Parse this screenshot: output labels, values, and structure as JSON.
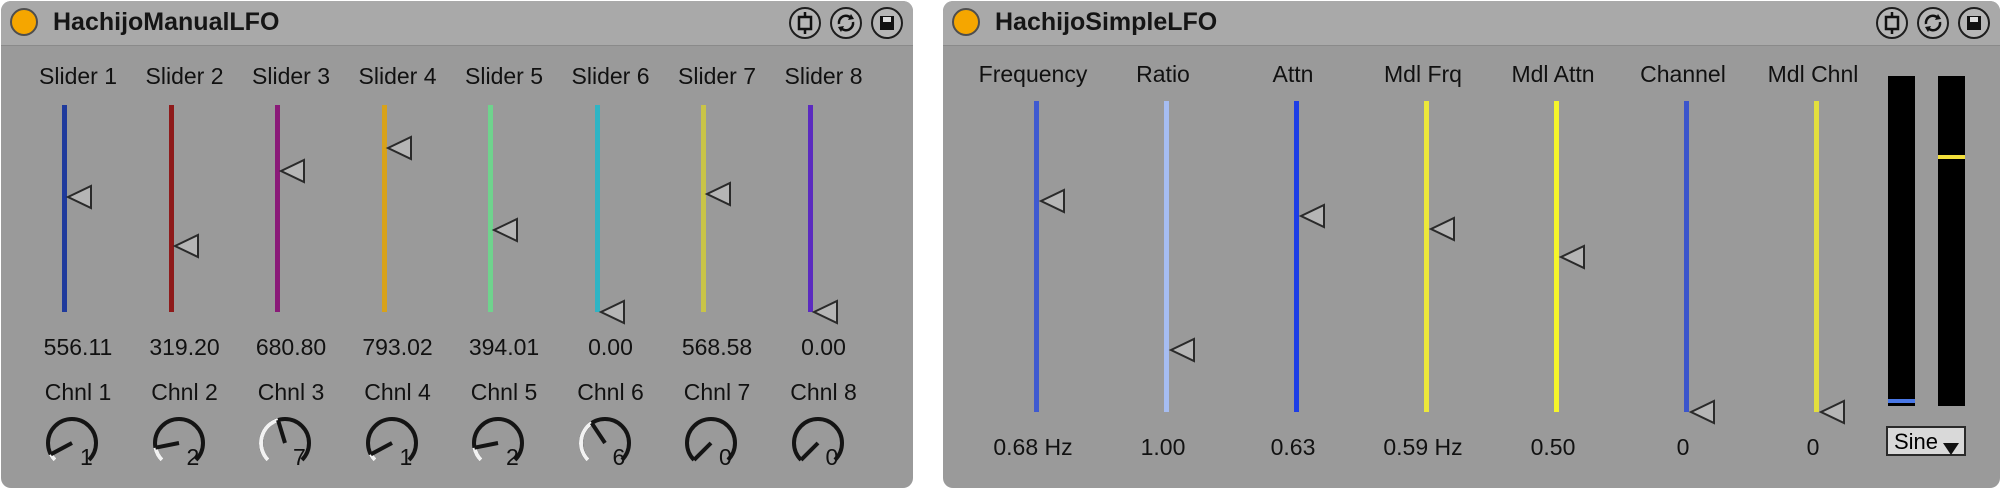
{
  "devices": [
    {
      "title": "HachijoManualLFO",
      "sliders": [
        {
          "label": "Slider 1",
          "value": "556.11",
          "color": "#1f3a9c",
          "level": 0.556
        },
        {
          "label": "Slider 2",
          "value": "319.20",
          "color": "#8e1a1a",
          "level": 0.319
        },
        {
          "label": "Slider 3",
          "value": "680.80",
          "color": "#8a1a78",
          "level": 0.681
        },
        {
          "label": "Slider 4",
          "value": "793.02",
          "color": "#d7a21b",
          "level": 0.793
        },
        {
          "label": "Slider 5",
          "value": "394.01",
          "color": "#6fd38d",
          "level": 0.394
        },
        {
          "label": "Slider 6",
          "value": "0.00",
          "color": "#2fb4c4",
          "level": 0.0
        },
        {
          "label": "Slider 7",
          "value": "568.58",
          "color": "#c9c448",
          "level": 0.569
        },
        {
          "label": "Slider 8",
          "value": "0.00",
          "color": "#5b2ac0",
          "level": 0.0
        }
      ],
      "channels": [
        {
          "label": "Chnl 1",
          "value": "1",
          "level": 0.0625
        },
        {
          "label": "Chnl 2",
          "value": "2",
          "level": 0.125
        },
        {
          "label": "Chnl 3",
          "value": "7",
          "level": 0.4375
        },
        {
          "label": "Chnl 4",
          "value": "1",
          "level": 0.0625
        },
        {
          "label": "Chnl 5",
          "value": "2",
          "level": 0.125
        },
        {
          "label": "Chnl 6",
          "value": "6",
          "level": 0.375
        },
        {
          "label": "Chnl 7",
          "value": "0",
          "level": 0.0
        },
        {
          "label": "Chnl 8",
          "value": "0",
          "level": 0.0
        }
      ]
    },
    {
      "title": "HachijoSimpleLFO",
      "params": [
        {
          "label": "Frequency",
          "value": "0.68 Hz",
          "color": "#3f5ad0",
          "level": 0.68
        },
        {
          "label": "Ratio",
          "value": "1.00",
          "color": "#a6bdf2",
          "level": 0.2
        },
        {
          "label": "Attn",
          "value": "0.63",
          "color": "#1e3ee6",
          "level": 0.63
        },
        {
          "label": "Mdl Frq",
          "value": "0.59 Hz",
          "color": "#ece83a",
          "level": 0.59
        },
        {
          "label": "Mdl Attn",
          "value": "0.50",
          "color": "#f5f52a",
          "level": 0.5
        },
        {
          "label": "Channel",
          "value": "0",
          "color": "#3b55cc",
          "level": 0.0
        },
        {
          "label": "Mdl Chnl",
          "value": "0",
          "color": "#e3df3d",
          "level": 0.0
        }
      ],
      "meters": [
        {
          "level": 0.01,
          "color": "#4a78e6"
        },
        {
          "level": 0.75,
          "color": "#f3e03a"
        }
      ],
      "waveform": "Sine"
    }
  ]
}
